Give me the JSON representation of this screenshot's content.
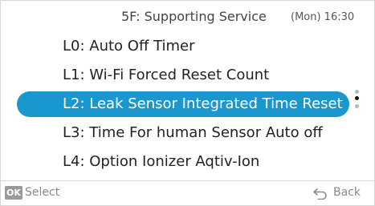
{
  "header": {
    "title": "5F: Supporting Service",
    "time": "(Mon) 16:30"
  },
  "menu": {
    "items": [
      {
        "label": "L0: Auto Off Timer"
      },
      {
        "label": "L1: Wi-Fi Forced Reset Count"
      },
      {
        "label": "L2: Leak Sensor Integrated Time Reset",
        "selected": true
      },
      {
        "label": "L3: Time For human Sensor Auto off"
      },
      {
        "label": "L4: Option Ionizer Aqtiv-Ion"
      }
    ]
  },
  "footer": {
    "ok_badge": "OK",
    "select_label": "Select",
    "back_label": "Back",
    "back_icon": "return-arrow-icon"
  },
  "colors": {
    "highlight": "#1a97cf",
    "text": "#222222",
    "muted": "#8a8a8a"
  }
}
